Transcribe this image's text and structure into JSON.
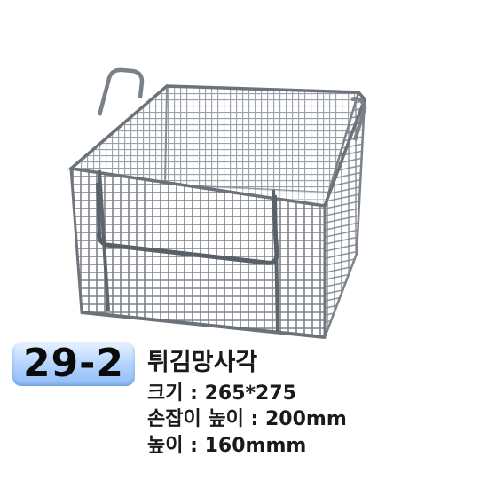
{
  "badge": {
    "model_number": "29-2"
  },
  "product": {
    "name": "튀김망사각",
    "size": "크기 : 265*275",
    "handle_height": "손잡이 높이 : 200mm",
    "height": "높이 : 160mmm"
  },
  "colors": {
    "badge_light": "#eaf3ff",
    "badge_dark": "#8fbcf6",
    "wire": "#8a8f96",
    "text": "#1a1a1a"
  },
  "photo": {
    "subject": "wire-mesh-basket",
    "icon": "mesh-basket-image"
  }
}
